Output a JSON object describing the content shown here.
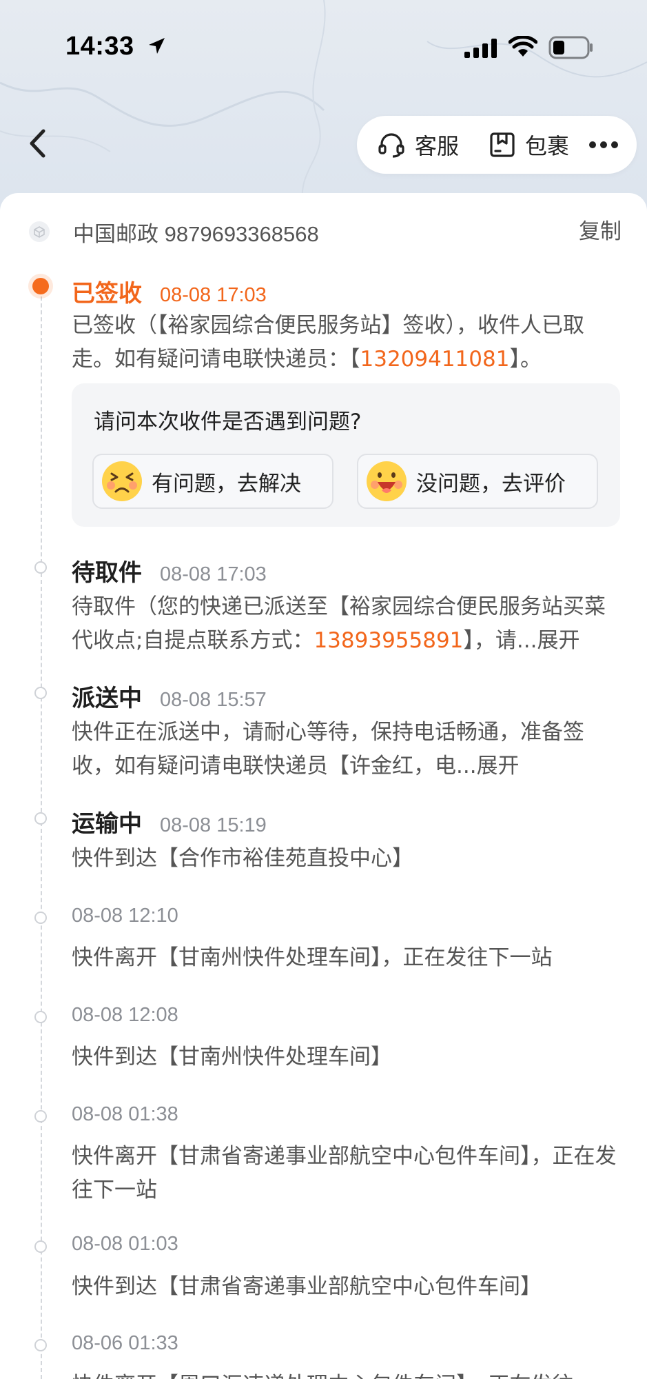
{
  "status_bar": {
    "time": "14:33"
  },
  "header": {
    "service_label": "客服",
    "package_label": "包裹"
  },
  "carrier": {
    "text": "中国邮政 9879693368568",
    "copy_label": "复制"
  },
  "latest": {
    "status": "已签收",
    "time": "08-08 17:03",
    "desc_a": "已签收（【裕家园综合便民服务站】签收），收件人已取走。如有疑问请电联快递员：【",
    "phone": "13209411081",
    "desc_b": "】。"
  },
  "feedback": {
    "question": "请问本次收件是否遇到问题?",
    "problem_label": "有问题，去解决",
    "ok_label": "没问题，去评价"
  },
  "events": [
    {
      "status": "待取件",
      "time": "08-08 17:03",
      "desc_a": "待取件（您的快递已派送至【裕家园综合便民服务站买菜代收点;自提点联系方式：",
      "phone": "13893955891",
      "desc_b": "】，请...",
      "expand": "展开"
    },
    {
      "status": "派送中",
      "time": "08-08 15:57",
      "desc_a": "快件正在派送中，请耐心等待，保持电话畅通，准备签收，如有疑问请电联快递员【许金红，电...",
      "expand": "展开"
    },
    {
      "status": "运输中",
      "time": "08-08 15:19",
      "desc": "快件到达【合作市裕佳苑直投中心】"
    },
    {
      "time": "08-08 12:10",
      "desc": "快件离开【甘南州快件处理车间】，正在发往下一站"
    },
    {
      "time": "08-08 12:08",
      "desc": "快件到达【甘南州快件处理车间】"
    },
    {
      "time": "08-08 01:38",
      "desc": "快件离开【甘肃省寄递事业部航空中心包件车间】，正在发往下一站"
    },
    {
      "time": "08-08 01:03",
      "desc": "快件到达【甘肃省寄递事业部航空中心包件车间】"
    },
    {
      "time": "08-06 01:33",
      "desc": "快件离开【周口汇速递处理中心包件车间】，正在发往"
    }
  ],
  "colors": {
    "accent": "#f2661b",
    "text": "#1f1f1f",
    "muted": "#8c8f95"
  }
}
